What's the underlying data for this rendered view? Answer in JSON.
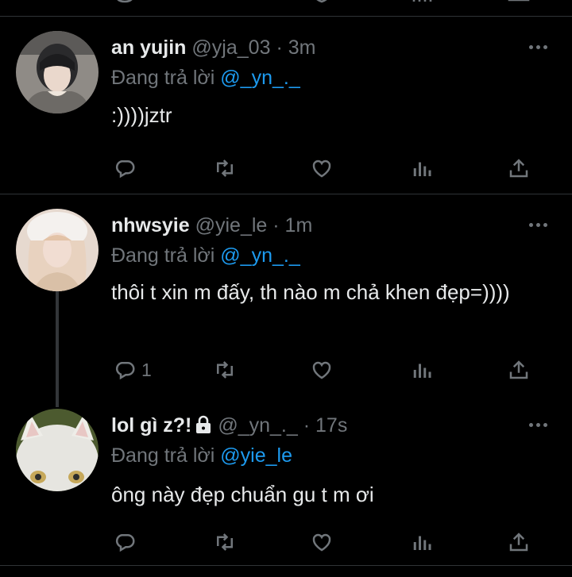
{
  "tweets": [
    {
      "name": "an yujin",
      "handle": "@yja_03",
      "dot": "·",
      "time": "3m",
      "reply_prefix": "Đang trả lời ",
      "reply_mention": "@_yn_._",
      "text": ":))))jztr",
      "reply_count": "",
      "avatar_colors": [
        "#3a3f44",
        "#c9c2bb"
      ]
    },
    {
      "name": "nhwsyie",
      "handle": "@yie_le",
      "dot": "·",
      "time": "1m",
      "reply_prefix": "Đang trả lời ",
      "reply_mention": "@_yn_._",
      "text": "thôi t xin m đấy, th nào m chả khen đẹp=))))",
      "reply_count": "1",
      "avatar_colors": [
        "#e9d7cf",
        "#f3eee8"
      ]
    },
    {
      "name": "lol gì z?!",
      "handle": "@_yn_._",
      "dot": "·",
      "time": "17s",
      "reply_prefix": "Đang trả lời ",
      "reply_mention": "@yie_le",
      "text": "ông này đẹp chuẩn gu t m ơi",
      "reply_count": "",
      "protected": true,
      "avatar_colors": [
        "#d8d8d3",
        "#5b6a3e"
      ]
    }
  ],
  "colors": {
    "background": "#000000",
    "text_primary": "#e7e9ea",
    "text_secondary": "#71767b",
    "mention": "#1d9bf0",
    "divider": "#2f3336"
  },
  "icons": [
    "reply-icon",
    "retweet-icon",
    "like-icon",
    "views-icon",
    "share-icon",
    "more-icon",
    "lock-icon"
  ]
}
